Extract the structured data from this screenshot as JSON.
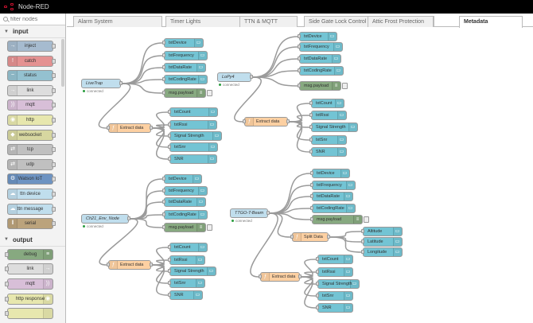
{
  "app": {
    "title": "Node-RED"
  },
  "palette": {
    "search_placeholder": "filter nodes",
    "categories": [
      {
        "label": "input",
        "nodes": [
          {
            "label": "inject",
            "color": "#a6bbcf",
            "icon": "inject-icon",
            "glyph": "→",
            "side": "left"
          },
          {
            "label": "catch",
            "color": "#e49191",
            "icon": "catch-icon",
            "glyph": "!",
            "side": "left"
          },
          {
            "label": "status",
            "color": "#94c1d0",
            "icon": "status-icon",
            "glyph": "~",
            "side": "left"
          },
          {
            "label": "link",
            "color": "#dddddd",
            "icon": "link-icon",
            "glyph": "→",
            "side": "left"
          },
          {
            "label": "mqtt",
            "color": "#d8bfd8",
            "icon": "mqtt-icon",
            "glyph": "))",
            "side": "left"
          },
          {
            "label": "http",
            "color": "#e7e7ae",
            "icon": "http-icon",
            "glyph": "◉",
            "side": "left"
          },
          {
            "label": "websocket",
            "color": "#d7d7a0",
            "icon": "websocket-icon",
            "glyph": "◆",
            "side": "left"
          },
          {
            "label": "tcp",
            "color": "#c0c0c0",
            "icon": "tcp-icon",
            "glyph": "⇄",
            "side": "left"
          },
          {
            "label": "udp",
            "color": "#c0c0c0",
            "icon": "udp-icon",
            "glyph": "⇄",
            "side": "left"
          },
          {
            "label": "Watson IoT",
            "color": "#6d93c2",
            "icon": "watson-iot-icon",
            "glyph": "⚙",
            "side": "left"
          },
          {
            "label": "ttn device",
            "color": "#c0deed",
            "icon": "ttn-device-icon",
            "glyph": "☁",
            "side": "left"
          },
          {
            "label": "ttn message",
            "color": "#c0deed",
            "icon": "ttn-message-icon",
            "glyph": "☁",
            "side": "left"
          },
          {
            "label": "serial",
            "color": "#bba37c",
            "icon": "serial-icon",
            "glyph": "‖",
            "side": "left"
          }
        ]
      },
      {
        "label": "output",
        "nodes": [
          {
            "label": "debug",
            "color": "#87a980",
            "icon": "debug-icon",
            "glyph": "≡",
            "side": "right"
          },
          {
            "label": "link",
            "color": "#dddddd",
            "icon": "link-out-icon",
            "glyph": "→",
            "side": "right"
          },
          {
            "label": "mqtt",
            "color": "#d8bfd8",
            "icon": "mqtt-out-icon",
            "glyph": "))",
            "side": "right"
          },
          {
            "label": "http response",
            "color": "#e7e7ae",
            "icon": "http-response-icon",
            "glyph": "◉",
            "side": "right"
          },
          {
            "label": "",
            "color": "#e7e7ae",
            "icon": "http-out-icon",
            "glyph": "",
            "side": "right"
          }
        ]
      }
    ]
  },
  "tabs": [
    {
      "label": "Alarm System",
      "active": false
    },
    {
      "label": "Timer Lights",
      "active": false
    },
    {
      "label": "TTN & MQTT",
      "active": false
    },
    {
      "label": "Side Gate Lock Control",
      "active": false
    },
    {
      "label": "Attic Frost Protection",
      "active": false
    },
    {
      "label": "Metadata",
      "active": true
    }
  ],
  "flow": {
    "colors": {
      "ttn": "#c0deed",
      "func": "#fdd0a2",
      "out": "#73c4d4",
      "debug": "#87a980"
    },
    "nodes": [
      {
        "id": "in1",
        "type": "ttn",
        "label": "LiveTrap",
        "status": "connected"
      },
      {
        "id": "in2",
        "type": "ttn",
        "label": "LoPy4",
        "status": "connected"
      },
      {
        "id": "in3",
        "type": "ttn",
        "label": "Ch21_Env_Node",
        "status": "connected"
      },
      {
        "id": "in4",
        "type": "ttn",
        "label": "TTGO-T-Beam",
        "status": "connected"
      },
      {
        "id": "a1",
        "type": "out",
        "label": "txtDevice"
      },
      {
        "id": "a2",
        "type": "out",
        "label": "txtFrequency"
      },
      {
        "id": "a3",
        "type": "out",
        "label": "txtDataRate"
      },
      {
        "id": "a4",
        "type": "out",
        "label": "txtCodingRate"
      },
      {
        "id": "a5",
        "type": "debug",
        "label": "msg.payload"
      },
      {
        "id": "af",
        "type": "func",
        "label": "Extract data"
      },
      {
        "id": "a6",
        "type": "out",
        "label": "txtCount"
      },
      {
        "id": "a7",
        "type": "out",
        "label": "txtRssi"
      },
      {
        "id": "a8",
        "type": "out",
        "label": "Signal Strength"
      },
      {
        "id": "a9",
        "type": "out",
        "label": "txtSnr"
      },
      {
        "id": "a10",
        "type": "out",
        "label": "SNR"
      },
      {
        "id": "b1",
        "type": "out",
        "label": "txtDevice"
      },
      {
        "id": "b2",
        "type": "out",
        "label": "txtFrequency"
      },
      {
        "id": "b3",
        "type": "out",
        "label": "txtDataRate"
      },
      {
        "id": "b4",
        "type": "out",
        "label": "txtCodingRate"
      },
      {
        "id": "b5",
        "type": "debug",
        "label": "msg.payload"
      },
      {
        "id": "bf",
        "type": "func",
        "label": "Extract data"
      },
      {
        "id": "b6",
        "type": "out",
        "label": "txtCount"
      },
      {
        "id": "b7",
        "type": "out",
        "label": "txtRssi"
      },
      {
        "id": "b8",
        "type": "out",
        "label": "Signal Strength"
      },
      {
        "id": "b9",
        "type": "out",
        "label": "txtSnr"
      },
      {
        "id": "b10",
        "type": "out",
        "label": "SNR"
      },
      {
        "id": "c1",
        "type": "out",
        "label": "txtDevice"
      },
      {
        "id": "c2",
        "type": "out",
        "label": "txtFrequency"
      },
      {
        "id": "c3",
        "type": "out",
        "label": "txtDataRate"
      },
      {
        "id": "c4",
        "type": "out",
        "label": "txtCodingRate"
      },
      {
        "id": "c5",
        "type": "debug",
        "label": "msg.payload"
      },
      {
        "id": "cf",
        "type": "func",
        "label": "Extract data"
      },
      {
        "id": "c6",
        "type": "out",
        "label": "txtCount"
      },
      {
        "id": "c7",
        "type": "out",
        "label": "txtRssi"
      },
      {
        "id": "c8",
        "type": "out",
        "label": "Signal Strength"
      },
      {
        "id": "c9",
        "type": "out",
        "label": "txtSnr"
      },
      {
        "id": "c10",
        "type": "out",
        "label": "SNR"
      },
      {
        "id": "d1",
        "type": "out",
        "label": "txtDevice"
      },
      {
        "id": "d2",
        "type": "out",
        "label": "txtFrequency"
      },
      {
        "id": "d3",
        "type": "out",
        "label": "txtDataRate"
      },
      {
        "id": "d4",
        "type": "out",
        "label": "txtCodingRate"
      },
      {
        "id": "d5",
        "type": "debug",
        "label": "msg.payload"
      },
      {
        "id": "ds",
        "type": "func",
        "label": "Split Data"
      },
      {
        "id": "d11",
        "type": "out",
        "label": "Altitude"
      },
      {
        "id": "d12",
        "type": "out",
        "label": "Latitude"
      },
      {
        "id": "d13",
        "type": "out",
        "label": "Longitude"
      },
      {
        "id": "df",
        "type": "func",
        "label": "Extract data"
      },
      {
        "id": "d6",
        "type": "out",
        "label": "txtCount"
      },
      {
        "id": "d7",
        "type": "out",
        "label": "txtRssi"
      },
      {
        "id": "d8",
        "type": "out",
        "label": "Signal Strength"
      },
      {
        "id": "d9",
        "type": "out",
        "label": "txtSnr"
      },
      {
        "id": "d10",
        "type": "out",
        "label": "SNR"
      }
    ],
    "wires": [
      [
        "in1",
        "a1"
      ],
      [
        "in1",
        "a2"
      ],
      [
        "in1",
        "a3"
      ],
      [
        "in1",
        "a4"
      ],
      [
        "in1",
        "a5"
      ],
      [
        "in1",
        "af"
      ],
      [
        "af",
        "a6"
      ],
      [
        "af",
        "a7"
      ],
      [
        "af",
        "a8"
      ],
      [
        "af",
        "a9"
      ],
      [
        "af",
        "a10"
      ],
      [
        "in2",
        "b1"
      ],
      [
        "in2",
        "b2"
      ],
      [
        "in2",
        "b3"
      ],
      [
        "in2",
        "b4"
      ],
      [
        "in2",
        "b5"
      ],
      [
        "in2",
        "bf"
      ],
      [
        "bf",
        "b6"
      ],
      [
        "bf",
        "b7"
      ],
      [
        "bf",
        "b8"
      ],
      [
        "bf",
        "b9"
      ],
      [
        "bf",
        "b10"
      ],
      [
        "in3",
        "c1"
      ],
      [
        "in3",
        "c2"
      ],
      [
        "in3",
        "c3"
      ],
      [
        "in3",
        "c4"
      ],
      [
        "in3",
        "c5"
      ],
      [
        "in3",
        "cf"
      ],
      [
        "cf",
        "c6"
      ],
      [
        "cf",
        "c7"
      ],
      [
        "cf",
        "c8"
      ],
      [
        "cf",
        "c9"
      ],
      [
        "cf",
        "c10"
      ],
      [
        "in4",
        "d1"
      ],
      [
        "in4",
        "d2"
      ],
      [
        "in4",
        "d3"
      ],
      [
        "in4",
        "d4"
      ],
      [
        "in4",
        "d5"
      ],
      [
        "in4",
        "ds"
      ],
      [
        "in4",
        "df"
      ],
      [
        "ds",
        "d11"
      ],
      [
        "ds",
        "d12"
      ],
      [
        "ds",
        "d13"
      ],
      [
        "df",
        "d6"
      ],
      [
        "df",
        "d7"
      ],
      [
        "df",
        "d8"
      ],
      [
        "df",
        "d9"
      ],
      [
        "df",
        "d10"
      ]
    ]
  }
}
